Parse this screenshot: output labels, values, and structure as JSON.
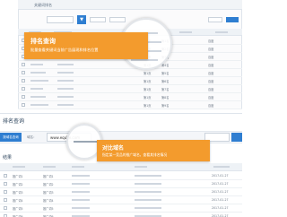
{
  "top": {
    "title": "关键词排名",
    "search_icon": "search-icon",
    "rows": [
      {
        "engine": "百度",
        "rank": "1",
        "page": "第1页",
        "pos": "第1名"
      },
      {
        "engine": "百度",
        "rank": "2",
        "page": "第1页",
        "pos": "第2名"
      },
      {
        "engine": "百度",
        "rank": "3",
        "page": "第1页",
        "pos": "第3名"
      },
      {
        "engine": "百度",
        "rank": "4",
        "page": "第1页",
        "pos": "第4名"
      },
      {
        "engine": "百度",
        "rank": "5",
        "page": "第1页",
        "pos": "第5名"
      },
      {
        "engine": "百度",
        "rank": "6",
        "page": "第1页",
        "pos": "第6名"
      },
      {
        "engine": "百度",
        "rank": "7",
        "page": "第1页",
        "pos": "第7名"
      },
      {
        "engine": "百度",
        "rank": "8",
        "page": "第1页",
        "pos": "第8名"
      },
      {
        "engine": "百度",
        "rank": "9",
        "page": "第1页",
        "pos": "第9名"
      }
    ]
  },
  "callout1": {
    "title": "排名查询",
    "desc": "批量查看关键词当前广告展现和排名位置"
  },
  "bottom": {
    "section_title": "排名查询",
    "tab_label": "按域名查询",
    "url_label": "域名：",
    "url_value": "www.eqube.com",
    "sub_title": "结果",
    "rows": [
      {
        "kw": "推广词1",
        "ad": "推广词1",
        "date": "2017-01-27"
      },
      {
        "kw": "推广词2",
        "ad": "推广词2",
        "date": "2017-01-27"
      },
      {
        "kw": "推广词3",
        "ad": "推广词3",
        "date": "2017-01-27"
      },
      {
        "kw": "推广词4",
        "ad": "推广词4",
        "date": "2017-01-27"
      },
      {
        "kw": "推广词5",
        "ad": "推广词5",
        "date": "2017-01-27"
      },
      {
        "kw": "推广词6",
        "ad": "推广词6",
        "date": "2017-01-27"
      }
    ]
  },
  "callout2": {
    "title": "对比域名",
    "desc": "指定某一竞品的推广域名，查看其排名情况"
  },
  "colors": {
    "accent": "#2f7ed1",
    "callout": "#f39b2d"
  }
}
